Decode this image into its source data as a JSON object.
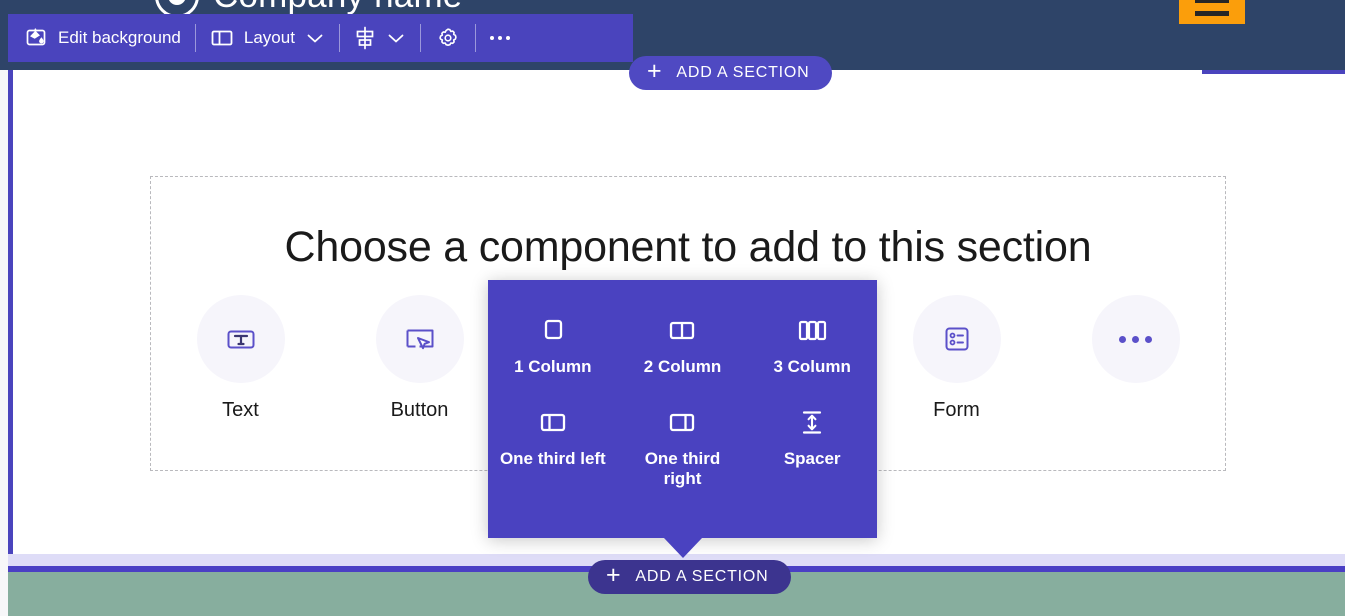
{
  "site_header": {
    "brand_name": "Company name",
    "logo_icon": "circle-logo-icon",
    "menu_icon": "hamburger-menu-icon"
  },
  "toolbar": {
    "edit_background": {
      "label": "Edit background",
      "icon": "paint-bucket-icon"
    },
    "layout": {
      "label": "Layout",
      "icon": "two-column-layout-icon",
      "chevron": "chevron-down-icon"
    },
    "align": {
      "icon": "align-distribute-icon",
      "chevron": "chevron-down-icon"
    },
    "settings": {
      "icon": "gear-icon"
    },
    "more": {
      "icon": "ellipsis-icon"
    }
  },
  "add_section": {
    "top_label": "ADD A SECTION",
    "bottom_label": "ADD A SECTION",
    "plus": "+"
  },
  "chooser": {
    "title": "Choose a component to add to this section",
    "components": [
      {
        "label": "Text",
        "icon": "text-box-icon"
      },
      {
        "label": "Button",
        "icon": "button-cursor-icon"
      },
      {
        "label": "",
        "icon": "hidden-component-icon"
      },
      {
        "label": "",
        "icon": "hidden-component-icon"
      },
      {
        "label": "Form",
        "icon": "form-list-icon"
      },
      {
        "label": "",
        "icon": "ellipsis-icon"
      }
    ]
  },
  "layout_flyout": {
    "options": [
      {
        "label": "1 Column",
        "icon": "one-column-icon"
      },
      {
        "label": "2 Column",
        "icon": "two-column-icon"
      },
      {
        "label": "3 Column",
        "icon": "three-column-icon"
      },
      {
        "label": "One third left",
        "icon": "one-third-left-icon"
      },
      {
        "label": "One third right",
        "icon": "one-third-right-icon"
      },
      {
        "label": "Spacer",
        "icon": "spacer-icon"
      }
    ]
  },
  "colors": {
    "toolbar_purple": "#4a44bd",
    "flyout_purple": "#4a42c0",
    "header_navy": "#2e4468",
    "accent_orange": "#fb9e0b",
    "section_green": "#87ae9e",
    "pill_dark": "#3c348f"
  }
}
